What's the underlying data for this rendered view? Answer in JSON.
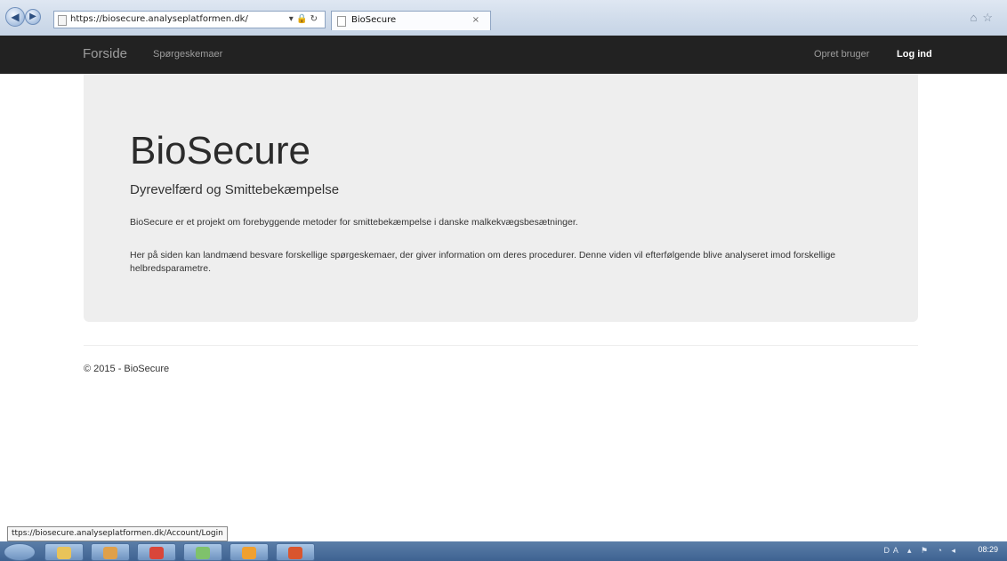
{
  "browser": {
    "url": "https://biosecure.analyseplatformen.dk/",
    "tab_title": "BioSecure",
    "tab_close": "×",
    "back_glyph": "◀",
    "forward_glyph": "▶",
    "address_icons": "▾ 🔒 ↻",
    "right_icons": "⌂☆"
  },
  "navbar": {
    "brand": "Forside",
    "links": [
      "Spørgeskemaer"
    ],
    "right_links": [
      "Opret bruger",
      "Log ind"
    ]
  },
  "jumbotron": {
    "title": "BioSecure",
    "subtitle": "Dyrevelfærd og Smittebekæmpelse",
    "paragraph1": "BioSecure er et projekt om forebyggende metoder for smittebekæmpelse i danske malkekvægsbesætninger.",
    "paragraph2": "Her på siden kan landmænd besvare forskellige spørgeskemaer, der giver information om deres procedurer. Denne viden vil efterfølgende blive analyseret imod forskellige helbredsparametre."
  },
  "footer": {
    "text": "© 2015 - BioSecure"
  },
  "status_bar": {
    "link_preview": "ttps://biosecure.analyseplatformen.dk/Account/Login"
  },
  "taskbar": {
    "apps": [
      {
        "name": "explorer",
        "color": "#e8c35a"
      },
      {
        "name": "media-player",
        "color": "#e0a04a"
      },
      {
        "name": "chrome",
        "color": "#d9463a"
      },
      {
        "name": "paint",
        "color": "#7fc26b"
      },
      {
        "name": "outlook",
        "color": "#f0a030"
      },
      {
        "name": "powerpoint",
        "color": "#d9552e"
      }
    ],
    "tray": "DA ▴ ⚑ ◔ ◂",
    "clock": "08:29"
  }
}
